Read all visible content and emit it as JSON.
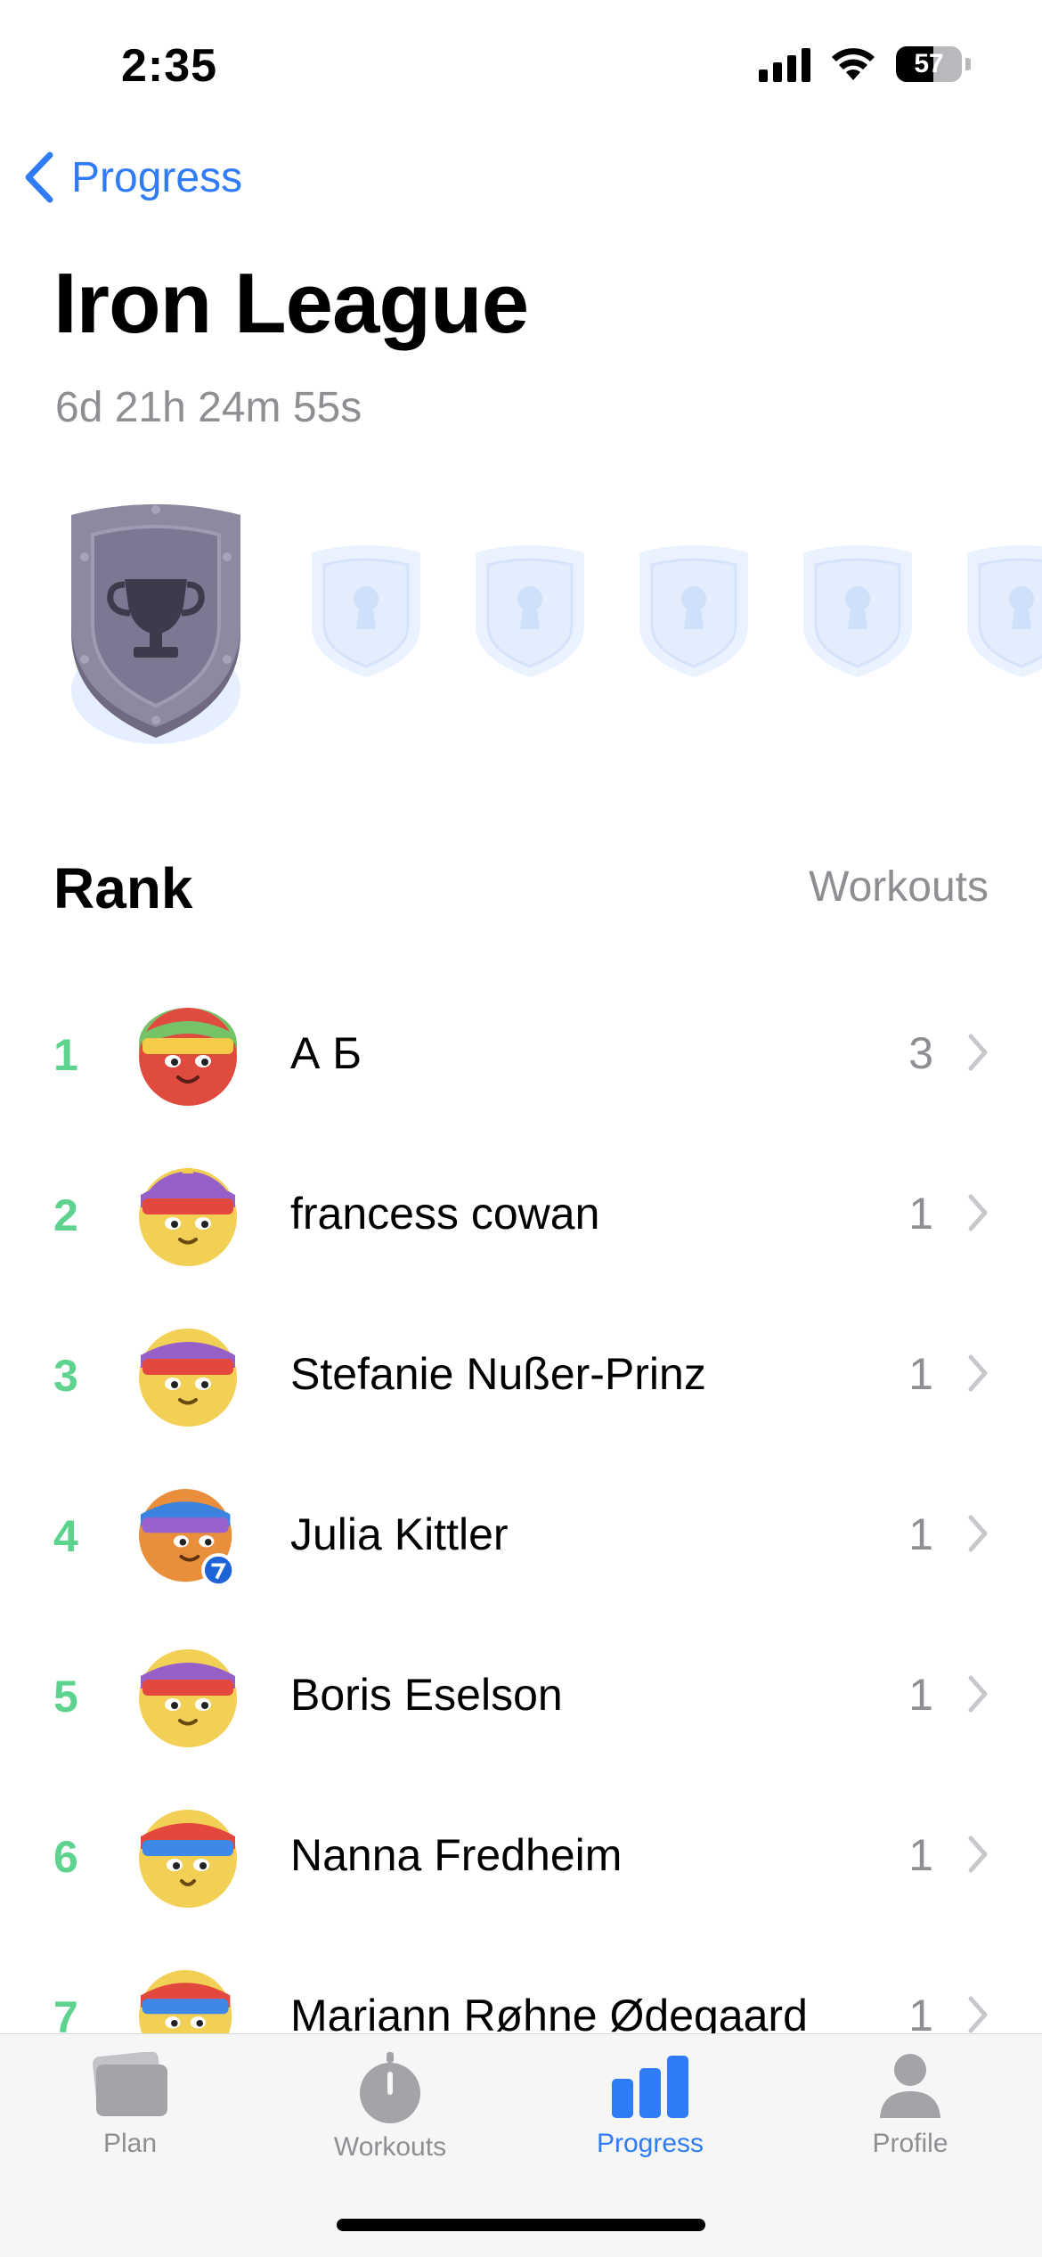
{
  "status": {
    "time": "2:35",
    "battery": "57",
    "battery_level_percent": 57
  },
  "nav": {
    "back_label": "Progress"
  },
  "header": {
    "title": "Iron League",
    "countdown": "6d 21h 24m 55s"
  },
  "leagues": {
    "current": "trophy-icon",
    "locked_icon": "keyhole-icon"
  },
  "table": {
    "rank_header": "Rank",
    "workouts_header": "Workouts",
    "rows": [
      {
        "rank": "1",
        "name": "А Б",
        "workouts": "3"
      },
      {
        "rank": "2",
        "name": "francess cowan",
        "workouts": "1"
      },
      {
        "rank": "3",
        "name": "Stefanie Nußer-Prinz",
        "workouts": "1"
      },
      {
        "rank": "4",
        "name": "Julia Kittler",
        "workouts": "1"
      },
      {
        "rank": "5",
        "name": "Boris Eselson",
        "workouts": "1"
      },
      {
        "rank": "6",
        "name": "Nanna Fredheim",
        "workouts": "1"
      },
      {
        "rank": "7",
        "name": "Mariann Røhne Ødegaard",
        "workouts": "1"
      }
    ]
  },
  "tabs": [
    {
      "label": "Plan",
      "icon": "cards-icon"
    },
    {
      "label": "Workouts",
      "icon": "stopwatch-icon"
    },
    {
      "label": "Progress",
      "icon": "bar-chart-icon"
    },
    {
      "label": "Profile",
      "icon": "person-icon"
    }
  ],
  "colors": {
    "accent": "#2f7cf6",
    "rank": "#5dd38d",
    "muted": "#8e8e93"
  }
}
